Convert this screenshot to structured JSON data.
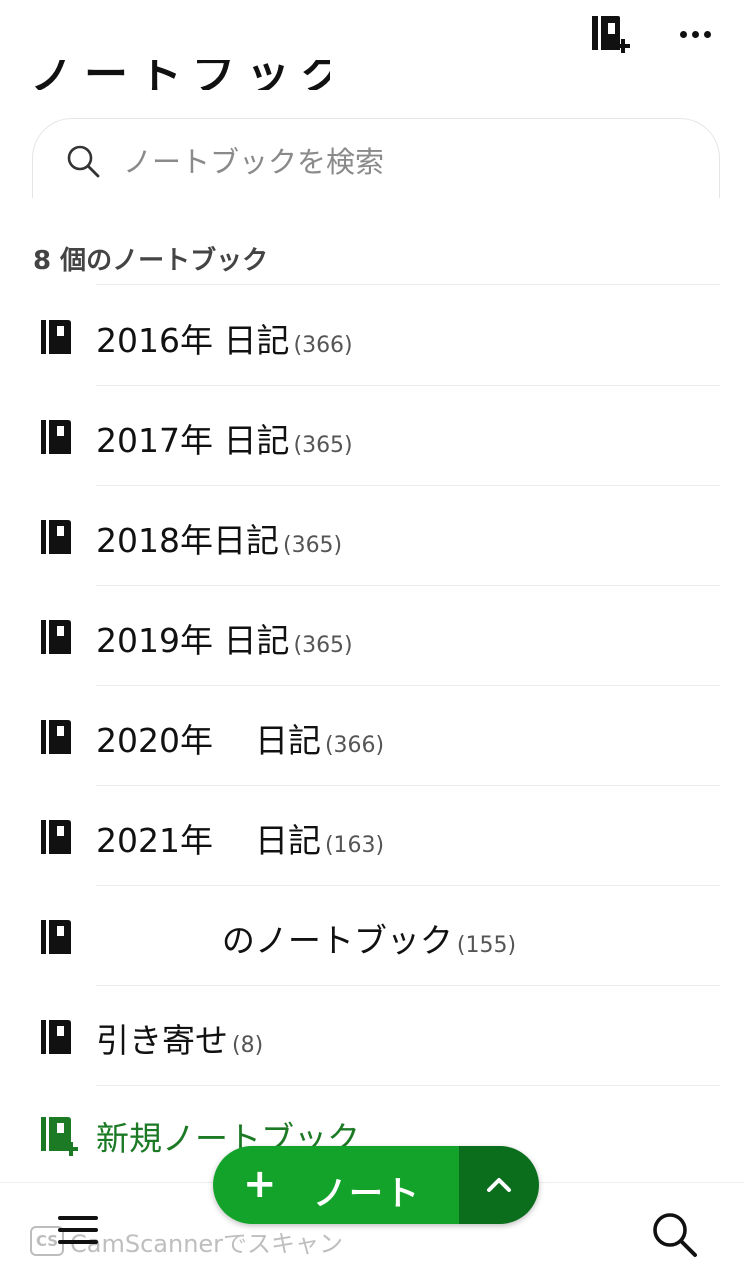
{
  "header": {
    "title_partial": "ノートブック"
  },
  "search": {
    "placeholder": "ノートブックを検索"
  },
  "summary": {
    "count_label": "8 個のノートブック"
  },
  "notebooks": [
    {
      "title": "2016年 日記",
      "count": "(366)"
    },
    {
      "title": "2017年 日記",
      "count": "(365)"
    },
    {
      "title": "2018年日記",
      "count": "(365)"
    },
    {
      "title": "2019年 日記",
      "count": "(365)"
    },
    {
      "title": "2020年    日記",
      "count": "(366)"
    },
    {
      "title": "2021年    日記",
      "count": "(163)"
    },
    {
      "title": "            のノートブック",
      "count": "(155)"
    },
    {
      "title": "引き寄せ",
      "count": "(8)"
    }
  ],
  "new_notebook": {
    "label": "新規ノートブック"
  },
  "fab": {
    "plus": "+",
    "label": "ノート"
  },
  "watermark": {
    "badge": "CS",
    "text": "CamScannerでスキャン"
  },
  "colors": {
    "accent_green": "#14a32a",
    "accent_green_dark": "#0b6e1d",
    "new_notebook_green": "#1c7a25"
  },
  "icons": {
    "top_add": "add-notebook-icon",
    "top_more": "more-icon",
    "search": "search-icon",
    "notebook": "notebook-icon",
    "menu": "menu-icon",
    "chevron": "chevron-up-icon"
  }
}
